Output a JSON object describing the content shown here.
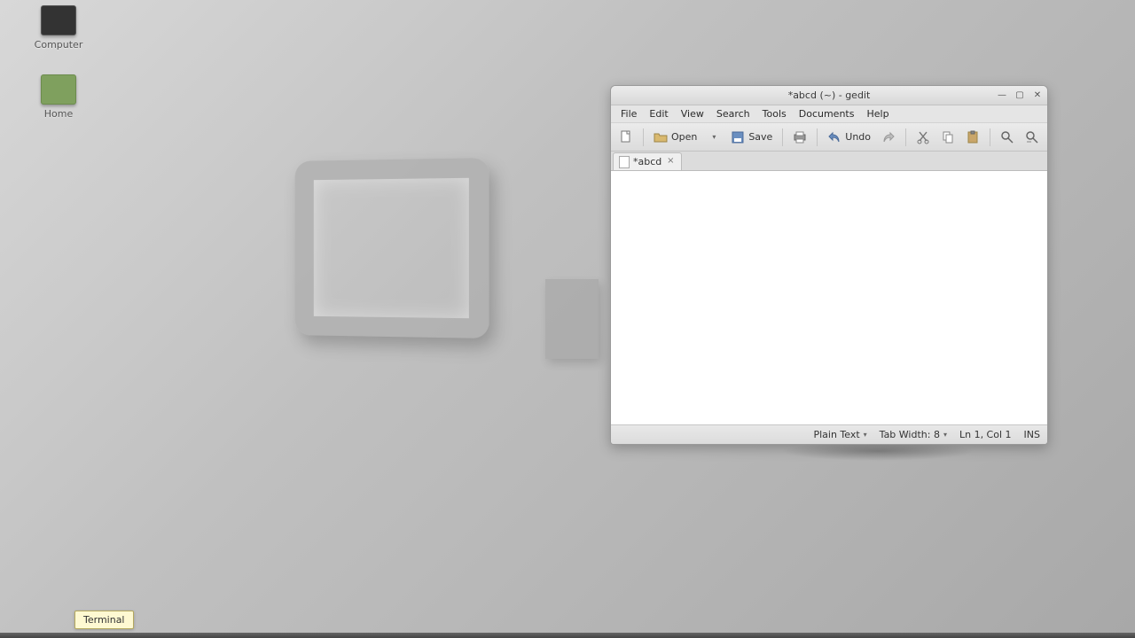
{
  "desktop": {
    "icons": [
      {
        "label": "Computer"
      },
      {
        "label": "Home"
      }
    ]
  },
  "window": {
    "title": "*abcd (~) - gedit",
    "menubar": [
      "File",
      "Edit",
      "View",
      "Search",
      "Tools",
      "Documents",
      "Help"
    ],
    "toolbar": {
      "open_label": "Open",
      "save_label": "Save",
      "undo_label": "Undo"
    },
    "tab": {
      "label": "*abcd"
    },
    "statusbar": {
      "syntax": "Plain Text",
      "tabwidth": "Tab Width: 8",
      "position": "Ln 1, Col 1",
      "insert": "INS"
    }
  },
  "tooltip": "Terminal"
}
